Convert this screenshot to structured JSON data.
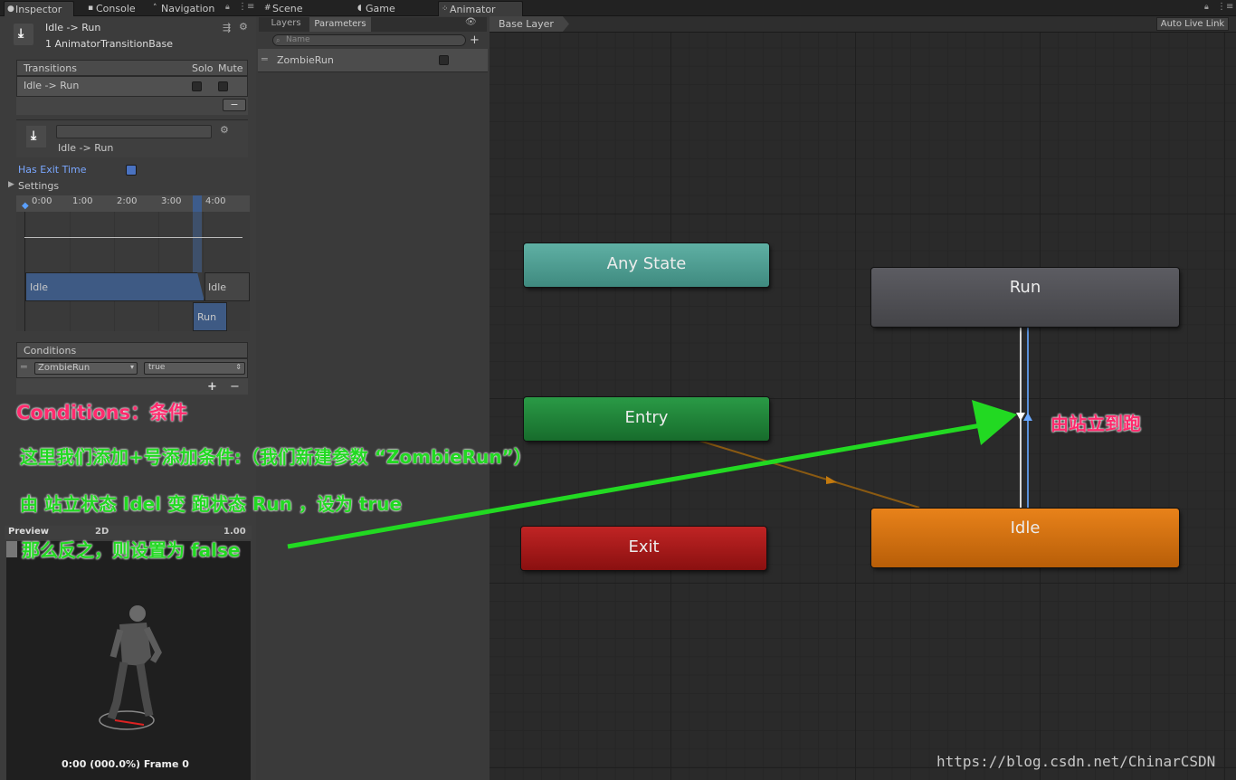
{
  "inspector_tabs": [
    "Inspector",
    "Console",
    "Navigation"
  ],
  "main_tabs": [
    "Scene",
    "Game",
    "Animator"
  ],
  "header": {
    "title": "Idle -> Run",
    "subtitle": "1 AnimatorTransitionBase"
  },
  "transitions": {
    "header": "Transitions",
    "solo": "Solo",
    "mute": "Mute",
    "row": "Idle -> Run"
  },
  "transition_detail": {
    "name_value": "",
    "label": "Idle -> Run"
  },
  "has_exit_time": {
    "label": "Has Exit Time",
    "checked": true
  },
  "settings_label": "Settings",
  "timeline": {
    "ticks": [
      "0:00",
      "1:00",
      "2:00",
      "3:00",
      "4:00"
    ],
    "bars": [
      "Idle",
      "Idle",
      "Run"
    ]
  },
  "conditions": {
    "header": "Conditions",
    "param": "ZombieRun",
    "value": "true"
  },
  "preview": {
    "label": "Preview",
    "mode": "2D",
    "speed": "1.00",
    "frame_text": "0:00 (000.0%) Frame 0"
  },
  "params_panel": {
    "tab_layers": "Layers",
    "tab_parameters": "Parameters",
    "search_placeholder": "Name",
    "param_name": "ZombieRun"
  },
  "graph": {
    "breadcrumb": "Base Layer",
    "auto_live_link": "Auto Live Link",
    "nodes": {
      "any_state": "Any State",
      "entry": "Entry",
      "exit": "Exit",
      "run": "Run",
      "idle": "Idle"
    }
  },
  "annotations": {
    "line1_en": "Conditions：",
    "line1_cn": "条件",
    "line2": "这里我们添加+号添加条件:（我们新建参数 “ZombieRun”）",
    "line3": "由 站立状态 Idel  变 跑状态 Run ，设为 true",
    "line4": "那么反之，则设置为 false",
    "arrow_label": "由站立到跑",
    "watermark": "https://blog.csdn.net/ChinarCSDN"
  },
  "colors": {
    "any_state": "#4f9a8f",
    "entry": "#1e7a34",
    "exit": "#a01818",
    "run": "#505055",
    "idle": "#cd6d0e",
    "arrow": "#22d922",
    "annotation_pink": "#ff2a6d"
  }
}
